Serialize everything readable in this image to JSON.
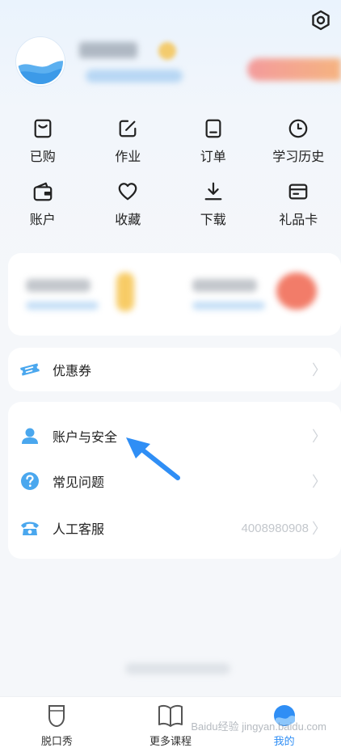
{
  "grid": [
    {
      "label": "已购",
      "icon": "bag-icon"
    },
    {
      "label": "作业",
      "icon": "edit-icon"
    },
    {
      "label": "订单",
      "icon": "order-icon"
    },
    {
      "label": "学习历史",
      "icon": "clock-icon"
    },
    {
      "label": "账户",
      "icon": "wallet-icon"
    },
    {
      "label": "收藏",
      "icon": "heart-icon"
    },
    {
      "label": "下载",
      "icon": "download-icon"
    },
    {
      "label": "礼品卡",
      "icon": "card-icon"
    }
  ],
  "coupon": {
    "label": "优惠券",
    "icon": "ticket-icon"
  },
  "menu": [
    {
      "label": "账户与安全",
      "icon": "user-icon"
    },
    {
      "label": "常见问题",
      "icon": "question-icon"
    },
    {
      "label": "人工客服",
      "icon": "phone-icon",
      "value": "4008980908"
    }
  ],
  "tabs": [
    {
      "label": "脱口秀",
      "icon": "mic-icon"
    },
    {
      "label": "更多课程",
      "icon": "book-icon"
    },
    {
      "label": "我的",
      "icon": "profile-tab-icon"
    }
  ],
  "chevron": "〉",
  "watermark": "Baidu经验 jingyan.baidu.com",
  "colors": {
    "accent": "#2f8ef5",
    "icon_blue": "#4aa7ee",
    "text": "#222222"
  }
}
